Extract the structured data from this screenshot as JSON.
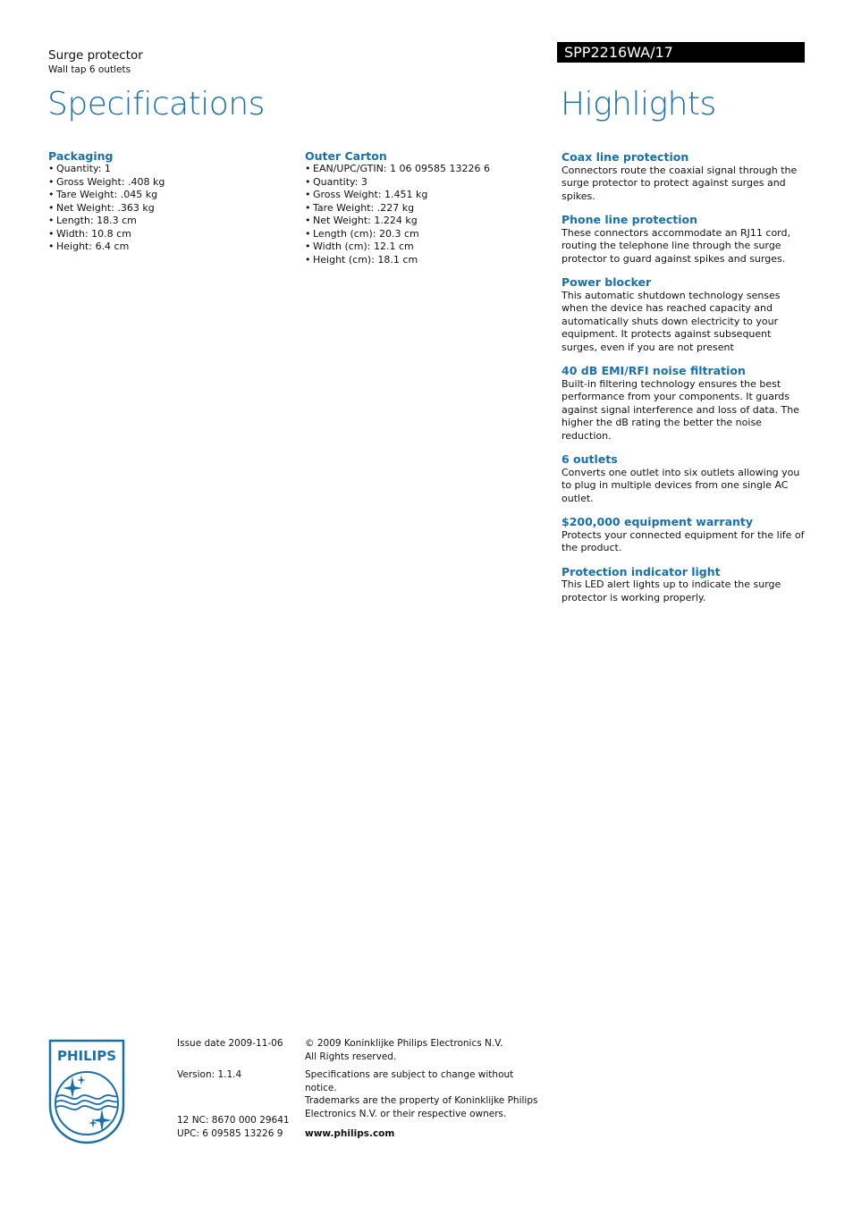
{
  "header": {
    "product_name": "Surge protector",
    "product_subtitle": "Wall tap 6 outlets",
    "model_number": "SPP2216WA/17",
    "specs_title": "Specifications",
    "highlights_title": "Highlights"
  },
  "specifications": {
    "packaging": {
      "title": "Packaging",
      "items": [
        "Quantity: 1",
        "Gross Weight: .408 kg",
        "Tare Weight: .045 kg",
        "Net Weight: .363 kg",
        "Length: 18.3 cm",
        "Width: 10.8 cm",
        "Height: 6.4 cm"
      ]
    },
    "outer_carton": {
      "title": "Outer Carton",
      "items": [
        "EAN/UPC/GTIN: 1 06 09585 13226 6",
        "Quantity: 3",
        "Gross Weight: 1.451 kg",
        "Tare Weight: .227 kg",
        "Net Weight: 1.224 kg",
        "Length (cm): 20.3 cm",
        "Width (cm): 12.1 cm",
        "Height (cm): 18.1 cm"
      ]
    }
  },
  "highlights": [
    {
      "title": "Coax line protection",
      "text": "Connectors route the coaxial signal through the surge protector to protect against surges and spikes."
    },
    {
      "title": "Phone line protection",
      "text": "These connectors accommodate an RJ11 cord, routing the telephone line through the surge protector to guard against spikes and surges."
    },
    {
      "title": "Power blocker",
      "text": "This automatic shutdown technology senses when the device has reached capacity and automatically shuts down electricity to your equipment. It protects against subsequent surges, even if you are not present"
    },
    {
      "title": "40 dB EMI/RFI noise filtration",
      "text": "Built-in filtering technology ensures the best performance from your components. It guards against signal interference and loss of data. The higher the dB rating the better the noise reduction."
    },
    {
      "title": "6 outlets",
      "text": "Converts one outlet into six outlets allowing you to plug in multiple devices from one single AC outlet."
    },
    {
      "title": "$200,000 equipment warranty",
      "text": "Protects your connected equipment for the life of the product."
    },
    {
      "title": "Protection indicator light",
      "text": "This LED alert lights up to indicate the surge protector is working properly."
    }
  ],
  "footer": {
    "logo_text": "PHILIPS",
    "issue_date": "Issue date 2009-11-06",
    "version": "Version: 1.1.4",
    "nc": "12 NC: 8670 000 29641",
    "upc": "UPC: 6 09585 13226 9",
    "copyright_line1": "© 2009 Koninklijke Philips Electronics N.V.",
    "copyright_line2": "All Rights reserved.",
    "disclaimer_line1": "Specifications are subject to change without notice.",
    "disclaimer_line2": "Trademarks are the property of Koninklijke Philips",
    "disclaimer_line3": "Electronics N.V. or their respective owners.",
    "website": "www.philips.com"
  },
  "colors": {
    "accent_blue": "#1a6fad",
    "banner_black": "#000000"
  }
}
